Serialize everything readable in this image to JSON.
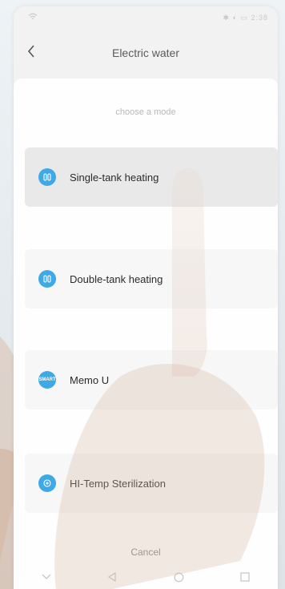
{
  "status_bar": {
    "right_text": "✱ ◐ ▭ 2:38"
  },
  "header": {
    "back_icon": "chevron-left-icon",
    "title": "Electric water"
  },
  "sheet": {
    "title": "choose a mode",
    "modes": [
      {
        "label": "Single-tank heating",
        "icon": "dual-bars-icon",
        "icon_text": "",
        "selected": true
      },
      {
        "label": "Double-tank heating",
        "icon": "dual-bars-icon",
        "icon_text": "",
        "selected": false
      },
      {
        "label": "Memo U",
        "icon": "smart-icon",
        "icon_text": "SMART",
        "selected": false
      },
      {
        "label": "HI-Temp Sterilization",
        "icon": "sterilize-icon",
        "icon_text": "",
        "selected": false
      }
    ],
    "cancel_label": "Cancel"
  },
  "nav_bar": {
    "items": [
      "chevron-down-icon",
      "back-triangle-icon",
      "home-circle-icon",
      "recent-square-icon"
    ]
  },
  "colors": {
    "accent": "#3fa9e6",
    "text_primary": "#2b2b2b",
    "text_muted": "#b8b8b8"
  }
}
